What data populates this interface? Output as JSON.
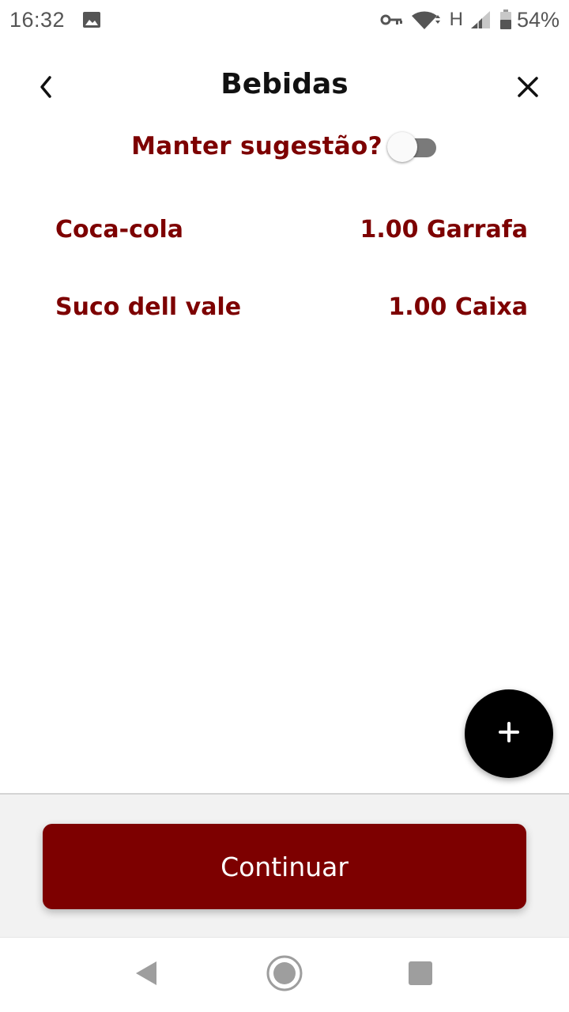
{
  "status_bar": {
    "time": "16:32",
    "network": "H",
    "battery": "54%",
    "icons": [
      "image-icon",
      "vpn-key-icon",
      "wifi-icon",
      "signal-icon",
      "battery-icon"
    ]
  },
  "header": {
    "title": "Bebidas",
    "back_icon": "chevron-left-icon",
    "close_icon": "close-icon"
  },
  "suggestion_toggle": {
    "label": "Manter sugestão?",
    "checked": false
  },
  "items": [
    {
      "name": "Coca-cola",
      "quantity": "1.00 Garrafa"
    },
    {
      "name": "Suco dell vale",
      "quantity": "1.00 Caixa"
    }
  ],
  "fab": {
    "icon": "plus-icon"
  },
  "continue_button": {
    "label": "Continuar"
  },
  "navigation": {
    "icons": [
      "nav-back-icon",
      "nav-home-icon",
      "nav-recents-icon"
    ]
  },
  "colors": {
    "accent": "#7d0000",
    "text_dark": "#111111",
    "fab": "#000000",
    "panel": "#f2f2f2"
  }
}
